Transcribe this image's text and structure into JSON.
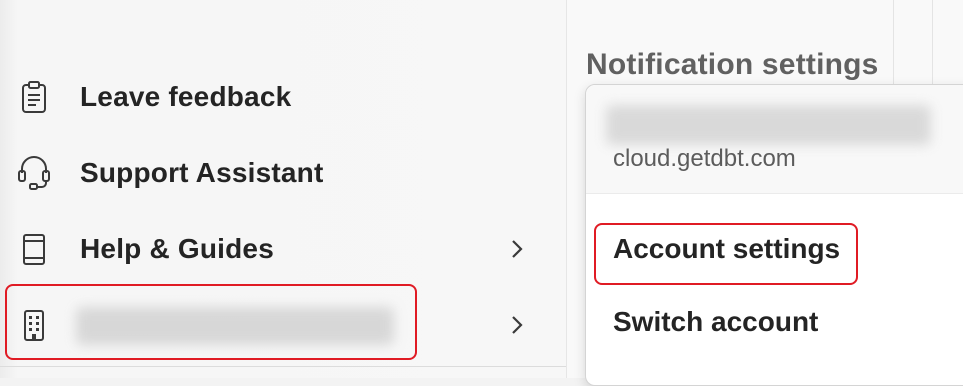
{
  "menu": {
    "items": [
      {
        "label": "Leave feedback",
        "icon": "clipboard-icon",
        "has_chevron": false
      },
      {
        "label": "Support Assistant",
        "icon": "headset-icon",
        "has_chevron": false
      },
      {
        "label": "Help & Guides",
        "icon": "book-icon",
        "has_chevron": true
      },
      {
        "label": "",
        "icon": "building-icon",
        "has_chevron": true,
        "redacted": true
      }
    ]
  },
  "notification_settings": {
    "title": "Notification settings"
  },
  "account_popup": {
    "domain": "cloud.getdbt.com",
    "items": [
      {
        "label": "Account settings"
      },
      {
        "label": "Switch account"
      }
    ]
  },
  "colors": {
    "highlight": "#e01b24",
    "text": "#242424",
    "muted_text": "#616161"
  }
}
